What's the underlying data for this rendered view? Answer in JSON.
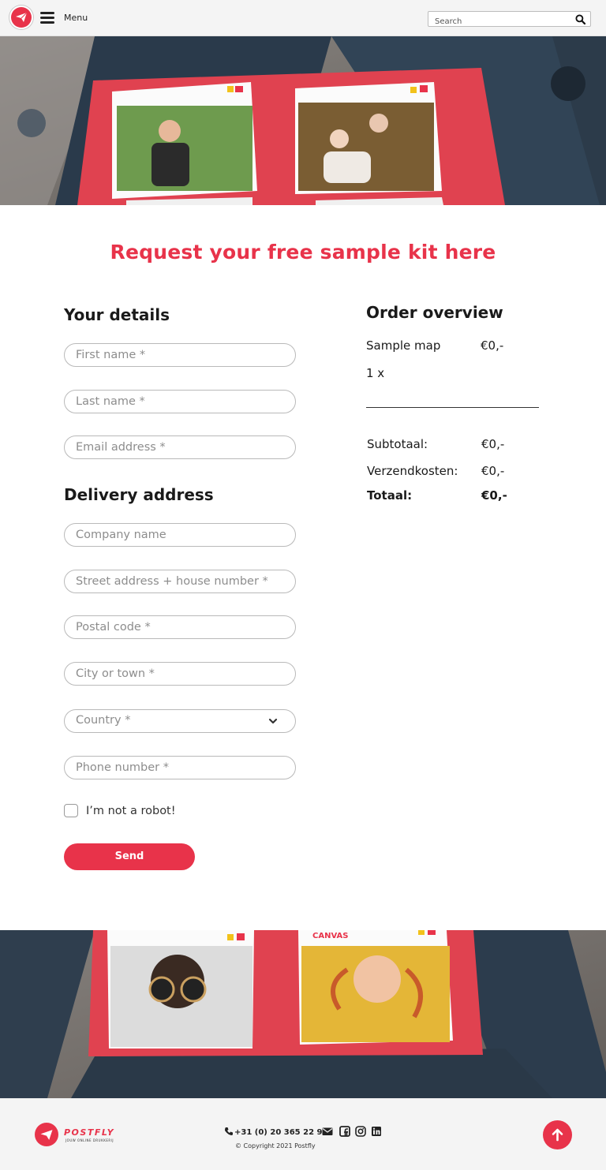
{
  "header": {
    "menu_label": "Menu",
    "search_placeholder": "Search"
  },
  "page": {
    "title": "Request your free sample kit here"
  },
  "form": {
    "details_heading": "Your details",
    "first_name_placeholder": "First name *",
    "last_name_placeholder": "Last name *",
    "email_placeholder": "Email address *",
    "delivery_heading": "Delivery address",
    "company_placeholder": "Company name",
    "street_placeholder": "Street address + house number *",
    "postal_placeholder": "Postal code *",
    "city_placeholder": "City or town *",
    "country_value": "Country *",
    "phone_placeholder": "Phone number *",
    "robot_label": "I’m not a robot!",
    "send_label": "Send"
  },
  "order": {
    "heading": "Order overview",
    "item_name": "Sample map",
    "item_price": "€0,-",
    "item_qty": "1 x",
    "subtotal_label": "Subtotaal:",
    "subtotal_value": "€0,-",
    "shipping_label": "Verzendkosten:",
    "shipping_value": "€0,-",
    "total_label": "Totaal:",
    "total_value": "€0,-"
  },
  "footer": {
    "brand": "POSTFLY",
    "tagline": "JOUW ONLINE DRUKKERIJ",
    "phone": "+31 (0) 20 365 22 93",
    "copyright": "© Copyright 2021 Postfly"
  },
  "icons": {
    "logo": "paper-plane-icon",
    "menu": "hamburger-icon",
    "search": "search-icon",
    "chevron": "chevron-down-icon",
    "phone": "phone-icon",
    "email": "envelope-icon",
    "facebook": "facebook-icon",
    "instagram": "instagram-icon",
    "linkedin": "linkedin-icon",
    "back_to_top": "arrow-up-icon"
  },
  "colors": {
    "brand_red": "#e8334a",
    "folder_red": "#e04250",
    "header_bg": "#f4f4f4"
  }
}
